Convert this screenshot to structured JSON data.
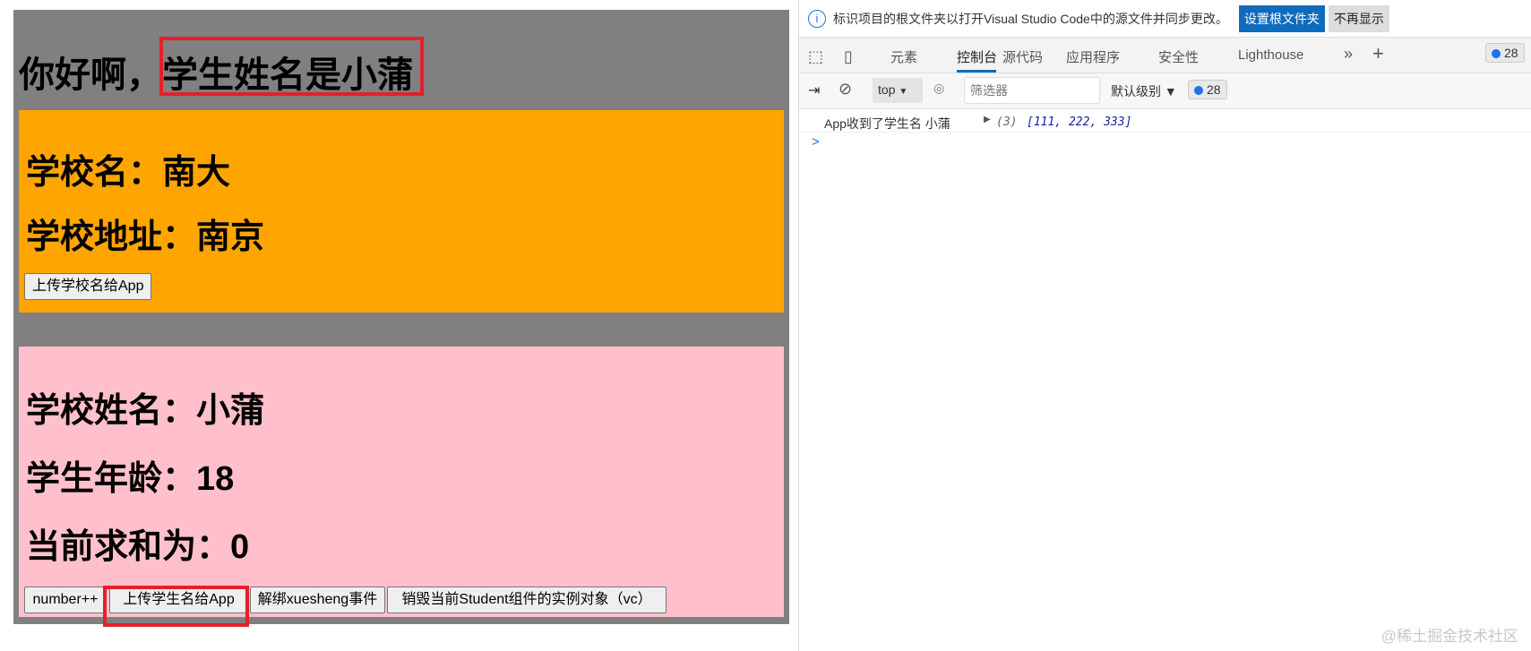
{
  "app": {
    "greeting": "你好啊，",
    "student_name_title": "学生姓名是小蒲",
    "school": {
      "name_line": "学校名：南大",
      "address_line": "学校地址：南京",
      "upload_button": "上传学校名给App"
    },
    "student": {
      "name_line": "学校姓名：小蒲",
      "age_line": "学生年龄：18",
      "sum_line": "当前求和为：0",
      "buttons": [
        "number++",
        "上传学生名给App",
        "解绑xuesheng事件",
        "销毁当前Student组件的实例对象（vc）"
      ]
    }
  },
  "devtools": {
    "info_bar": {
      "message": "标识项目的根文件夹以打开Visual Studio Code中的源文件并同步更改。",
      "primary_button": "设置根文件夹",
      "secondary_button": "不再显示"
    },
    "tabs": [
      "元素",
      "控制台",
      "源代码",
      "应用程序",
      "安全性",
      "Lighthouse"
    ],
    "active_tab": "控制台",
    "issues_count": "28",
    "toolbar": {
      "context": "top",
      "filter_placeholder": "筛选器",
      "level": "默认级别",
      "count": "28"
    },
    "console": {
      "log_text": "App收到了学生名 小蒲",
      "array_len": "(3)",
      "array_values": "[111, 222, 333]",
      "prompt": ">"
    }
  },
  "watermark": "@稀土掘金技术社区",
  "colors": {
    "school_bg": "#ffa500",
    "student_bg": "#ffc0cb",
    "app_bg": "#808080",
    "highlight": "#e3202a",
    "accent": "#0f6cbd"
  }
}
